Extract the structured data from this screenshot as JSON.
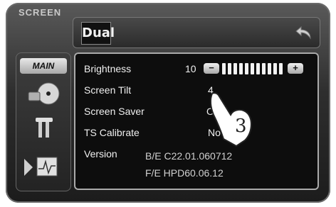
{
  "header": {
    "screen_label": "SCREEN",
    "logo": "Dual"
  },
  "sidebar": {
    "main_label": "MAIN",
    "items": [
      {
        "icon": "disc-icon"
      },
      {
        "icon": "tools-icon"
      },
      {
        "icon": "waveform-icon"
      }
    ]
  },
  "settings": {
    "brightness": {
      "label": "Brightness",
      "value": "10",
      "minus": "−",
      "plus": "+"
    },
    "tilt": {
      "label": "Screen Tilt",
      "value": "4"
    },
    "saver": {
      "label": "Screen  Saver",
      "value": "On"
    },
    "calibrate": {
      "label": "TS Calibrate",
      "value": "No"
    },
    "version": {
      "label": "Version",
      "be": "B/E  C22.01.060712",
      "fe": "F/E  HPD60.06.12"
    }
  },
  "annotation": {
    "step": "3"
  },
  "brightness_level_fraction": 1.0
}
